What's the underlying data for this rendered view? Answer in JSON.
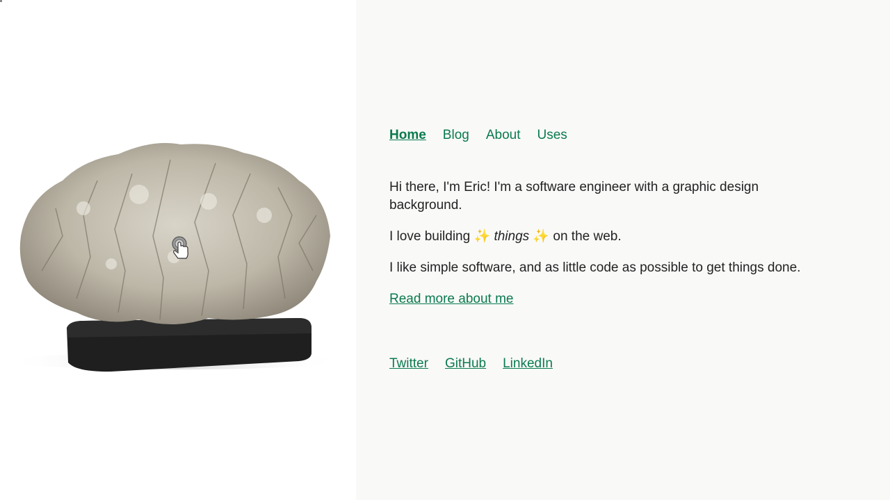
{
  "nav": {
    "items": [
      {
        "label": "Home",
        "active": true
      },
      {
        "label": "Blog",
        "active": false
      },
      {
        "label": "About",
        "active": false
      },
      {
        "label": "Uses",
        "active": false
      }
    ]
  },
  "intro": {
    "line1": "Hi there, I'm Eric! I'm a software engineer with a graphic design background.",
    "line2_before": "I love building",
    "sparkle": "✨",
    "line2_emph": "things",
    "line2_after": "on the web.",
    "line3": "I like simple software, and as little code as possible to get things done.",
    "read_more": "Read more about me"
  },
  "social": {
    "twitter": "Twitter",
    "github": "GitHub",
    "linkedin": "LinkedIn"
  },
  "viewer": {
    "object": "coral-on-black-stand",
    "hint_icon": "drag-hand-icon"
  },
  "colors": {
    "link": "#0b7a4e",
    "page_bg": "#f9f9f8",
    "left_bg": "#ffffff",
    "text": "#222222"
  }
}
